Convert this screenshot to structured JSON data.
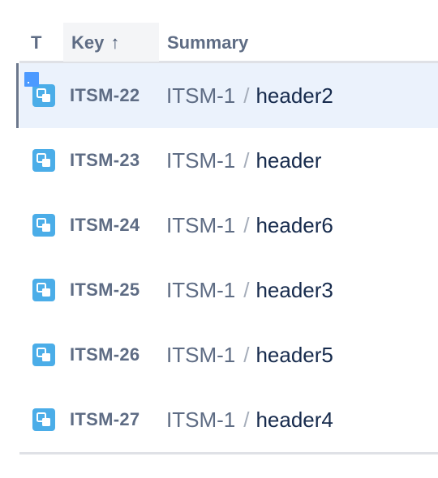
{
  "header": {
    "type_label": "T",
    "key_label": "Key",
    "sort_arrow": "↑",
    "summary_label": "Summary"
  },
  "issues": [
    {
      "key": "ITSM-22",
      "parent": "ITSM-1",
      "separator": "/",
      "summary": "header2",
      "type_icon": "subtask-icon",
      "selected": true
    },
    {
      "key": "ITSM-23",
      "parent": "ITSM-1",
      "separator": "/",
      "summary": "header",
      "type_icon": "subtask-icon",
      "selected": false
    },
    {
      "key": "ITSM-24",
      "parent": "ITSM-1",
      "separator": "/",
      "summary": "header6",
      "type_icon": "subtask-icon",
      "selected": false
    },
    {
      "key": "ITSM-25",
      "parent": "ITSM-1",
      "separator": "/",
      "summary": "header3",
      "type_icon": "subtask-icon",
      "selected": false
    },
    {
      "key": "ITSM-26",
      "parent": "ITSM-1",
      "separator": "/",
      "summary": "header5",
      "type_icon": "subtask-icon",
      "selected": false
    },
    {
      "key": "ITSM-27",
      "parent": "ITSM-1",
      "separator": "/",
      "summary": "header4",
      "type_icon": "subtask-icon",
      "selected": false
    }
  ],
  "colors": {
    "subtask_icon": "#4bade8",
    "selected_row": "#ebf2fc",
    "key_text": "#5e6c84",
    "summary_text": "#172b4d"
  }
}
